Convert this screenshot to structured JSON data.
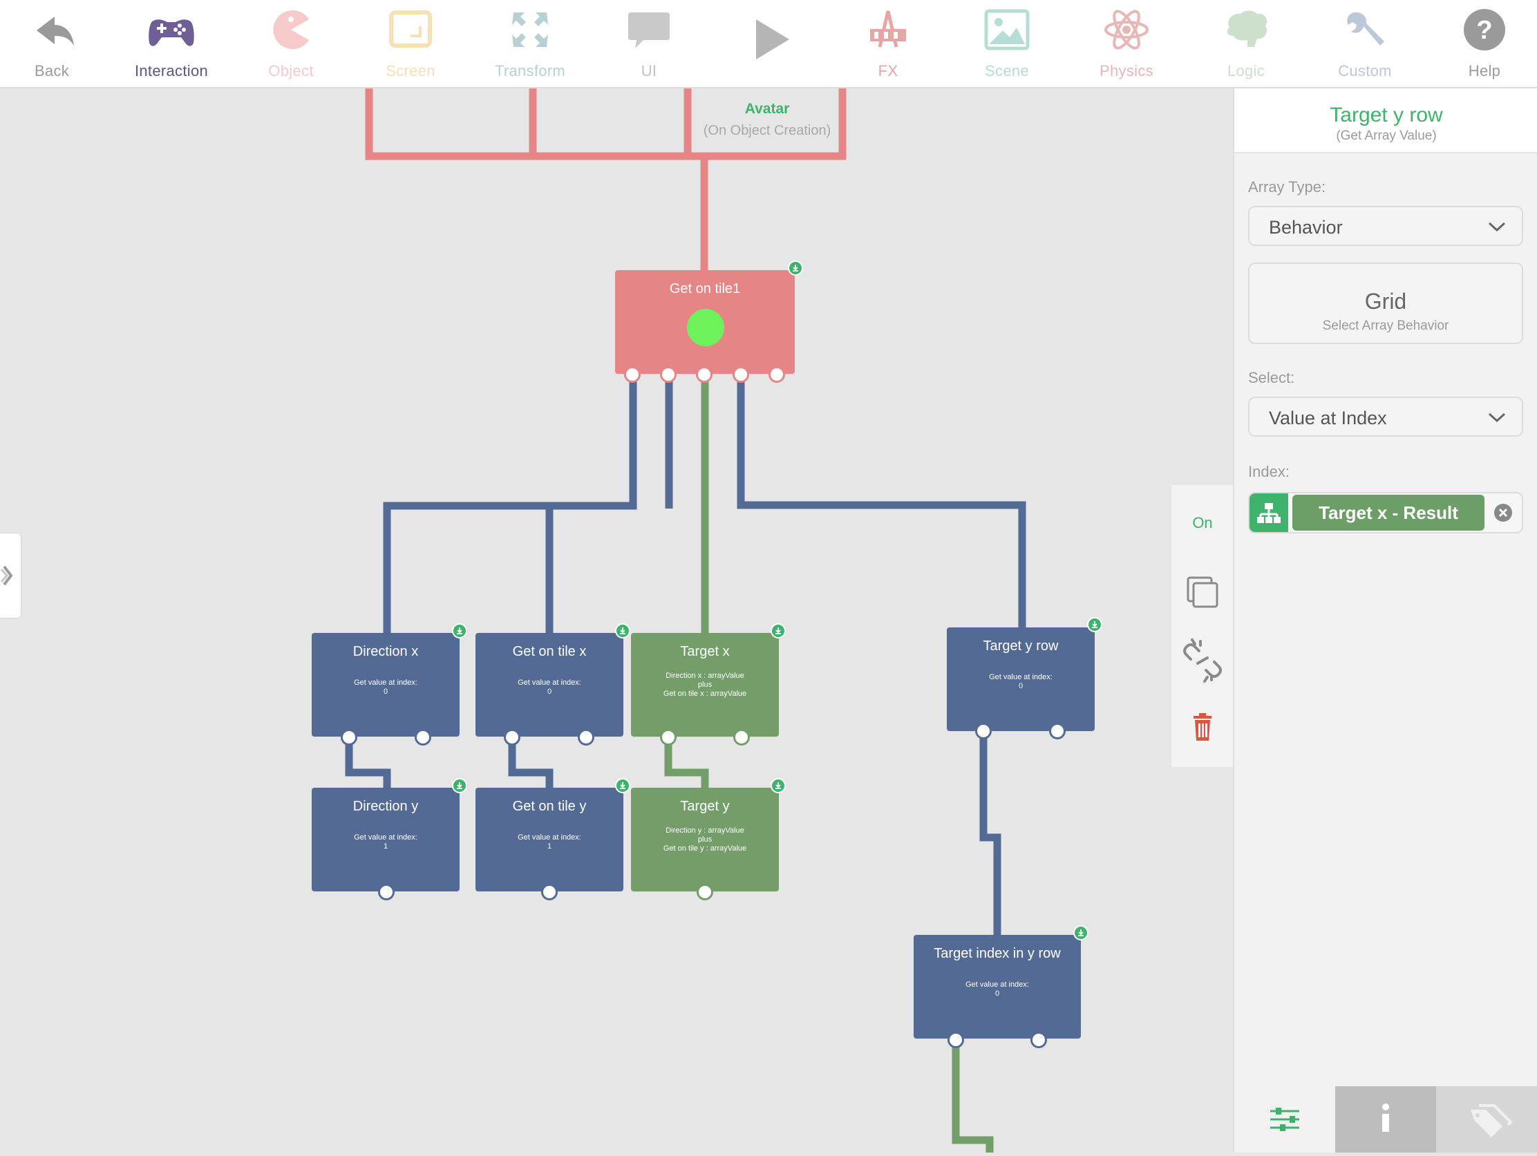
{
  "toolbar": {
    "items": [
      {
        "label": "Back",
        "icon": "back-arrow-icon",
        "color": "#9a9a9a"
      },
      {
        "label": "Interaction",
        "icon": "gamepad-icon",
        "color": "#6f5f96"
      },
      {
        "label": "Object",
        "icon": "pacman-icon",
        "color": "#f6caca"
      },
      {
        "label": "Screen",
        "icon": "screen-icon",
        "color": "#f7dfb6"
      },
      {
        "label": "Transform",
        "icon": "transform-icon",
        "color": "#b8d0d4"
      },
      {
        "label": "UI",
        "icon": "speech-bubble-icon",
        "color": "#b5b5b5"
      },
      {
        "label": "",
        "icon": "play-icon",
        "color": "#b5b5b5"
      },
      {
        "label": "FX",
        "icon": "fx-icon",
        "color": "#e9a5a5"
      },
      {
        "label": "Scene",
        "icon": "image-icon",
        "color": "#b5ddd6"
      },
      {
        "label": "Physics",
        "icon": "atom-icon",
        "color": "#e9b6b6"
      },
      {
        "label": "Logic",
        "icon": "brain-icon",
        "color": "#cce0cc"
      },
      {
        "label": "Custom",
        "icon": "wrench-icon",
        "color": "#bcc7d8"
      },
      {
        "label": "Help",
        "icon": "help-icon",
        "color": "#9a9a9a"
      }
    ]
  },
  "canvas": {
    "avatar": {
      "title": "Avatar",
      "subtitle": "(On Object Creation)"
    },
    "nodes": {
      "get_on_tile1": {
        "title": "Get on tile1"
      },
      "direction_x": {
        "title": "Direction x",
        "desc1": "Get value at index:",
        "desc2": "0"
      },
      "get_on_tile_x": {
        "title": "Get on tile x",
        "desc1": "Get value at index:",
        "desc2": "0"
      },
      "target_x": {
        "title": "Target x",
        "desc1": "Direction x : arrayValue",
        "desc2": "plus",
        "desc3": "Get on tile x : arrayValue"
      },
      "target_y_row": {
        "title": "Target y row",
        "desc1": "Get value at index:",
        "desc2": "0"
      },
      "direction_y": {
        "title": "Direction y",
        "desc1": "Get value at index:",
        "desc2": "1"
      },
      "get_on_tile_y": {
        "title": "Get on tile y",
        "desc1": "Get value at index:",
        "desc2": "1"
      },
      "target_y": {
        "title": "Target y",
        "desc1": "Direction y : arrayValue",
        "desc2": "plus",
        "desc3": "Get on tile y : arrayValue"
      },
      "target_index_in_y_row": {
        "title": "Target index in y row",
        "desc1": "Get value at index:",
        "desc2": "0"
      }
    }
  },
  "actions": {
    "on_label": "On"
  },
  "inspector": {
    "title": "Target y row",
    "subtitle": "(Get Array Value)",
    "array_type_label": "Array Type:",
    "array_type_value": "Behavior",
    "behavior_title": "Grid",
    "behavior_subtitle": "Select Array Behavior",
    "select_label": "Select:",
    "select_value": "Value at Index",
    "index_label": "Index:",
    "index_value": "Target x - Result"
  },
  "colors": {
    "accent": "#3db36b",
    "blue_node": "#536a94",
    "green_node": "#739e6a",
    "red_node": "#e58585",
    "delete": "#e0533d"
  }
}
